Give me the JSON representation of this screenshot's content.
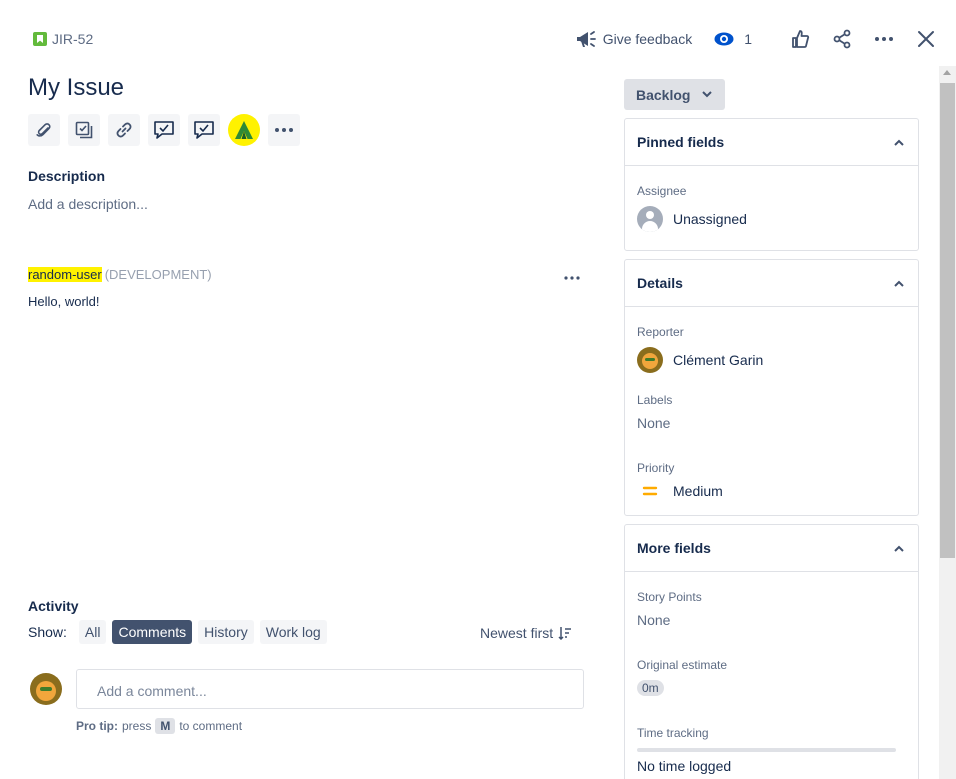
{
  "header": {
    "issue_key": "JIR-52",
    "give_feedback": "Give feedback",
    "watch_count": "1"
  },
  "issue": {
    "title": "My Issue",
    "description_heading": "Description",
    "description_placeholder": "Add a description..."
  },
  "toolbar": {
    "icons": [
      "attachment-icon",
      "child-issue-icon",
      "link-icon",
      "comment-check-icon",
      "comment-check-icon",
      "app-icon",
      "more-icon"
    ]
  },
  "comment": {
    "author": "random-user",
    "environment": "(DEVELOPMENT)",
    "body": "Hello, world!"
  },
  "activity": {
    "heading": "Activity",
    "show_label": "Show:",
    "filters": [
      "All",
      "Comments",
      "History",
      "Work log"
    ],
    "active_filter": "Comments",
    "sort_label": "Newest first",
    "comment_placeholder": "Add a comment...",
    "protip_bold": "Pro tip:",
    "protip_press": "press",
    "protip_key": "M",
    "protip_suffix": "to comment"
  },
  "status": {
    "label": "Backlog"
  },
  "pinned_fields": {
    "heading": "Pinned fields",
    "assignee_label": "Assignee",
    "assignee_value": "Unassigned"
  },
  "details": {
    "heading": "Details",
    "reporter_label": "Reporter",
    "reporter_value": "Clément Garin",
    "labels_label": "Labels",
    "labels_value": "None",
    "priority_label": "Priority",
    "priority_value": "Medium"
  },
  "more_fields": {
    "heading": "More fields",
    "story_points_label": "Story Points",
    "story_points_value": "None",
    "original_estimate_label": "Original estimate",
    "original_estimate_value": "0m",
    "time_tracking_label": "Time tracking",
    "time_tracking_value": "No time logged"
  },
  "colors": {
    "story": "#63ba3c",
    "highlight": "#fff200",
    "priority_medium": "#ffab00",
    "active_filter_bg": "#42526e"
  }
}
